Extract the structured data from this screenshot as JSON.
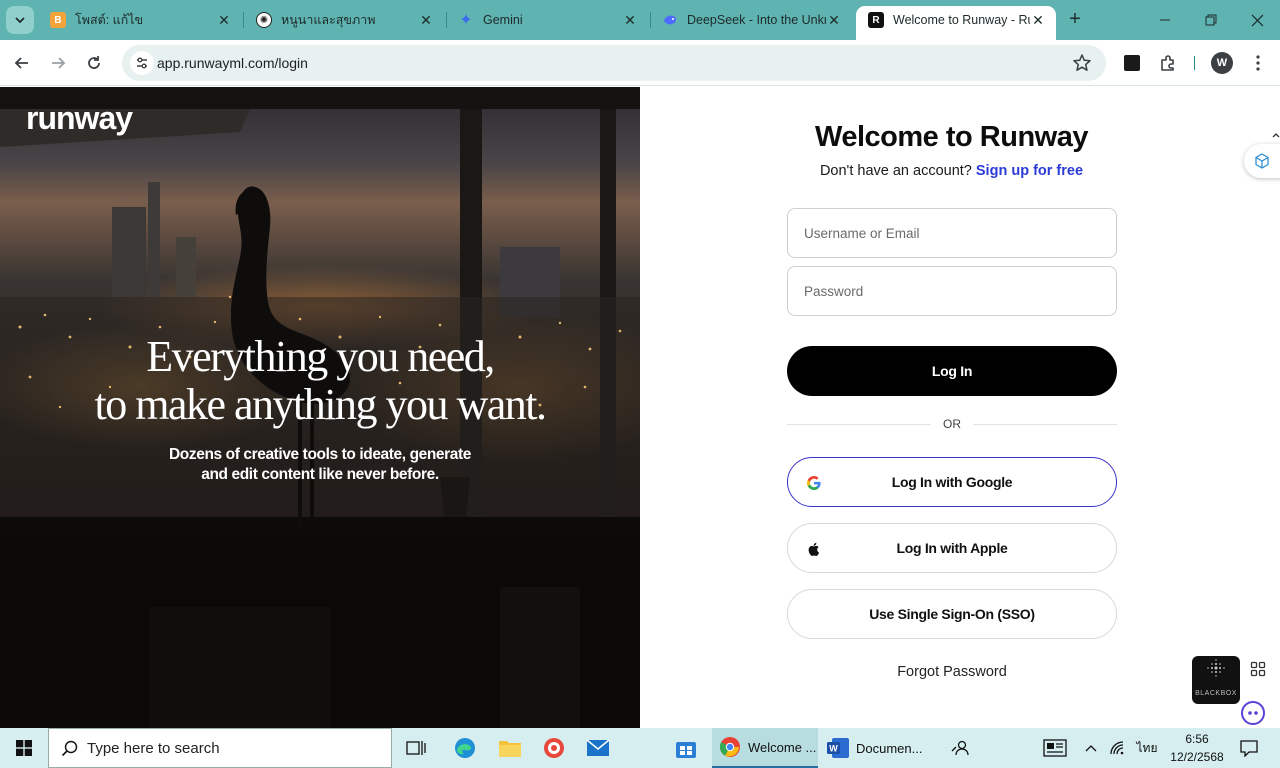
{
  "browser": {
    "tabs": [
      {
        "title": "โพสต์: แก้ไข",
        "icon": "blogger-icon",
        "color": "#f4a33b"
      },
      {
        "title": "หนูนาและสุขภาพ",
        "icon": "openai-icon",
        "color": "#222222"
      },
      {
        "title": "Gemini",
        "icon": "gemini-icon",
        "color": "#3b6cf0"
      },
      {
        "title": "DeepSeek - Into the Unkn",
        "icon": "deepseek-icon",
        "color": "#4d6bfe"
      },
      {
        "title": "Welcome to Runway - Ru",
        "icon": "runway-icon",
        "color": "#000000",
        "active": true
      }
    ],
    "url": "app.runwayml.com/login",
    "profile_initial": "W",
    "chrome_color": "#5fb3b0"
  },
  "hero": {
    "brand": "runway",
    "headline_line1": "Everything you need,",
    "headline_line2": "to make anything you want.",
    "sub_line1": "Dozens of creative tools to ideate, generate",
    "sub_line2": "and edit content like never before."
  },
  "login": {
    "title": "Welcome to Runway",
    "no_account": "Don't have an account?",
    "signup_link": "Sign up for free",
    "username_placeholder": "Username or Email",
    "password_placeholder": "Password",
    "login_button": "Log In",
    "or": "OR",
    "google_button": "Log In with Google",
    "apple_button": "Log In with Apple",
    "sso_button": "Use Single Sign-On (SSO)",
    "forgot": "Forgot Password",
    "link_color": "#2b3bd8"
  },
  "widgets": {
    "blackbox_label": "BLACKBOX"
  },
  "taskbar": {
    "search_placeholder": "Type here to search",
    "apps": [
      {
        "label": "Welcome ...",
        "icon": "chrome-icon",
        "active": true
      },
      {
        "label": "Documen...",
        "icon": "word-icon",
        "active": false
      }
    ],
    "language": "ไทย",
    "time": "6:56",
    "date": "12/2/2568"
  }
}
